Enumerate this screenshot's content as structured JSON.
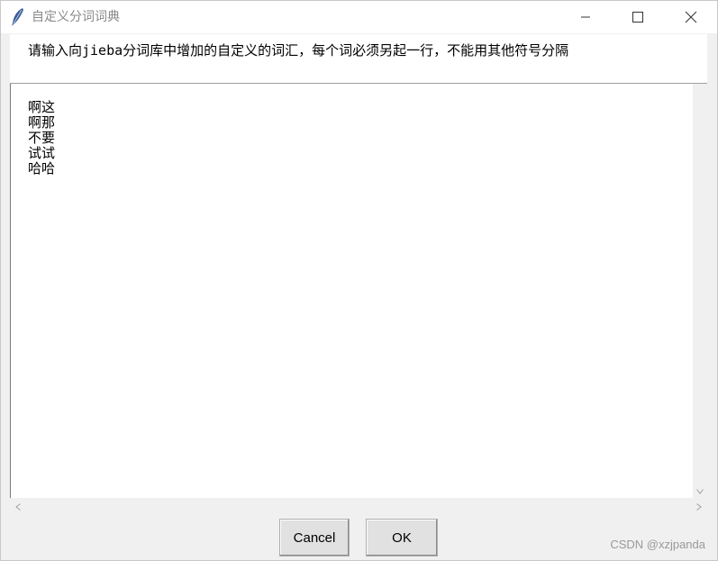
{
  "window": {
    "title": "自定义分词词典",
    "icon": "feather-icon"
  },
  "prompt": {
    "text": "请输入向jieba分词库中增加的自定义的词汇，每个词必须另起一行，不能用其他符号分隔"
  },
  "editor": {
    "lines": [
      "啊这",
      "啊那",
      "不要",
      "试试",
      "哈哈"
    ]
  },
  "buttons": {
    "cancel_label": "Cancel",
    "ok_label": "OK"
  },
  "watermark": "CSDN @xzjpanda"
}
